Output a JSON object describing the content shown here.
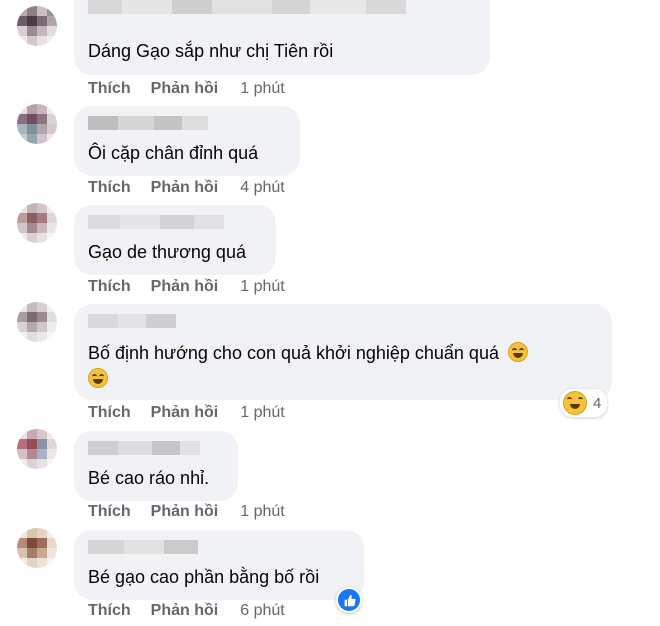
{
  "comments": [
    {
      "text": "Dáng Gạo sắp như chị Tiên rồi",
      "like": "Thích",
      "reply": "Phản hồi",
      "time": "1 phút"
    },
    {
      "text": "Ôi cặp chân đỉnh quá",
      "like": "Thích",
      "reply": "Phản hồi",
      "time": "4 phút"
    },
    {
      "text": "Gạo de thương quá",
      "like": "Thích",
      "reply": "Phản hồi",
      "time": "1 phút"
    },
    {
      "text": "Bố định hướng cho con quả khởi nghiệp chuẩn quá",
      "like": "Thích",
      "reply": "Phản hồi",
      "time": "1 phút",
      "reaction_count": "4"
    },
    {
      "text": "Bé cao ráo nhỉ.",
      "like": "Thích",
      "reply": "Phản hồi",
      "time": "1 phút"
    },
    {
      "text": "Bé gạo cao phần bằng bố rồi",
      "like": "Thích",
      "reply": "Phản hồi",
      "time": "6 phút"
    }
  ],
  "icons": {
    "laugh": "laughing-emoji-icon",
    "like": "thumbs-up-icon"
  },
  "colors": {
    "bubble": "#f0f2f5",
    "meta": "#65676b",
    "like_blue": "#1877f2"
  }
}
